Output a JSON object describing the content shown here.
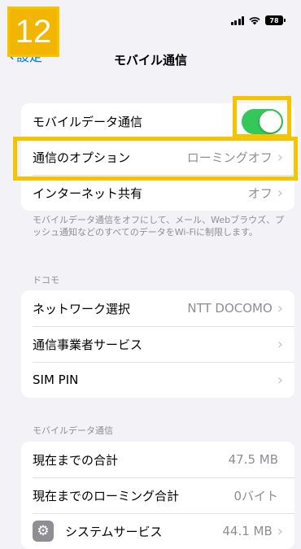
{
  "step_badge": "12",
  "status": {
    "battery": "78"
  },
  "nav": {
    "back_label": "設定",
    "title": "モバイル通信"
  },
  "group1": {
    "mobile_data_label": "モバイルデータ通信",
    "options_label": "通信のオプション",
    "options_value": "ローミングオフ",
    "hotspot_label": "インターネット共有",
    "hotspot_value": "オフ"
  },
  "note": "モバイルデータ通信をオフにして、メール、Webブラウズ、プッシュ通知などのすべてのデータをWi-Fiに制限します。",
  "carrier_header": "ドコモ",
  "carrier": {
    "network_label": "ネットワーク選択",
    "network_value": "NTT DOCOMO",
    "services_label": "通信事業者サービス",
    "simpin_label": "SIM PIN"
  },
  "usage_header": "モバイルデータ通信",
  "usage": {
    "current_label": "現在までの合計",
    "current_value": "47.5 MB",
    "roaming_label": "現在までのローミング合計",
    "roaming_value": "0バイト",
    "system_label": "システムサービス",
    "system_value": "44.1 MB"
  },
  "icons": {
    "chevron": "chevron-right-icon",
    "back": "chevron-left-icon",
    "system": "gear-icon"
  },
  "colors": {
    "highlight": "#f5c400",
    "toggle_on": "#34c759",
    "accent": "#007aff"
  }
}
